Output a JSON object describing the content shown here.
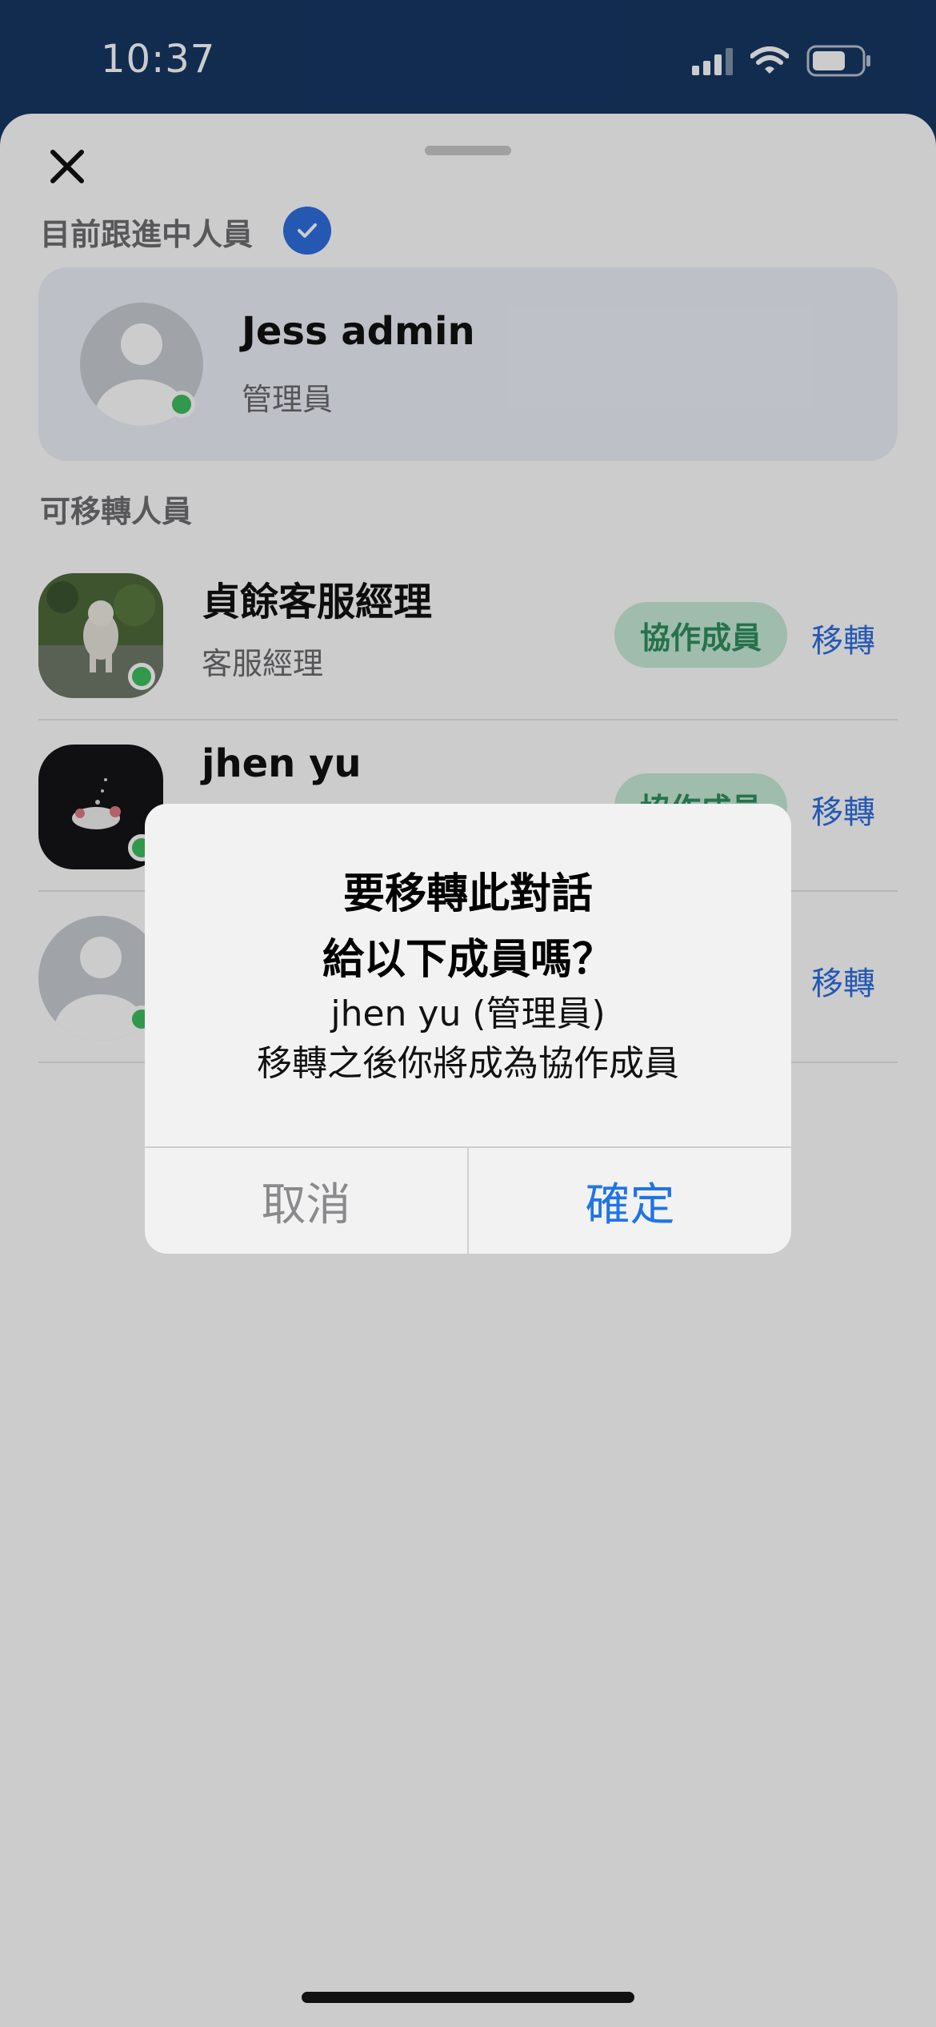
{
  "status_bar": {
    "time": "10:37"
  },
  "sheet": {
    "current_section_label": "目前跟進中人員",
    "current_member": {
      "name": "Jess admin",
      "role": "管理員"
    },
    "transferable_section_label": "可移轉人員",
    "members": [
      {
        "name": "貞餘客服經理",
        "role": "客服經理",
        "badge": "協作成員",
        "action": "移轉"
      },
      {
        "name": "jhen yu",
        "role": "",
        "badge": "協作成員",
        "action": "移轉"
      },
      {
        "name": "",
        "role": "",
        "badge": "",
        "action": "移轉"
      }
    ]
  },
  "dialog": {
    "title_line1": "要移轉此對話",
    "title_line2": "給以下成員嗎？",
    "message_line1": "jhen yu (管理員)",
    "message_line2": "移轉之後你將成為協作成員",
    "cancel_label": "取消",
    "confirm_label": "確定"
  },
  "colors": {
    "header_bg": "#173765",
    "accent_blue": "#2f6fe0",
    "online_green": "#3fbf5f",
    "collab_pill_bg": "#c7ecd9",
    "collab_pill_text": "#2f8f5e"
  }
}
